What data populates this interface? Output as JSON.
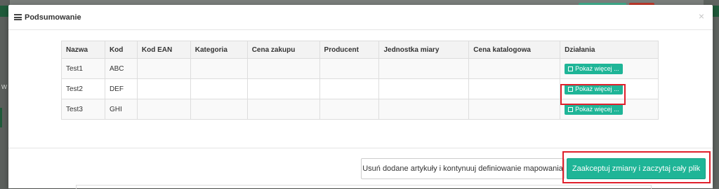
{
  "modal": {
    "title": "Podsumowanie",
    "close_symbol": "×",
    "icon": "list-icon"
  },
  "table": {
    "headers": [
      "Nazwa",
      "Kod",
      "Kod EAN",
      "Kategoria",
      "Cena zakupu",
      "Producent",
      "Jednostka miary",
      "Cena katalogowa",
      "Działania"
    ],
    "rows": [
      {
        "name": "Test1",
        "code": "ABC",
        "ean": "",
        "category": "",
        "purchase_price": "",
        "producer": "",
        "unit": "",
        "catalog_price": "",
        "action_label": "Pokaż więcej ..."
      },
      {
        "name": "Test2",
        "code": "DEF",
        "ean": "",
        "category": "",
        "purchase_price": "",
        "producer": "",
        "unit": "",
        "catalog_price": "",
        "action_label": "Pokaż więcej ..."
      },
      {
        "name": "Test3",
        "code": "GHI",
        "ean": "",
        "category": "",
        "purchase_price": "",
        "producer": "",
        "unit": "",
        "catalog_price": "",
        "action_label": "Pokaż więcej ..."
      }
    ]
  },
  "footer": {
    "remove_label": "Usuń dodane artykuły i kontynuuj definiowanie mapowania",
    "accept_label": "Zaakceptuj zmiany i zaczytaj cały plik"
  },
  "backdrop": {
    "edge_letter": "w"
  },
  "colors": {
    "accent": "#1fb597",
    "highlight": "#e0202c",
    "overlay": "#5f6460"
  }
}
